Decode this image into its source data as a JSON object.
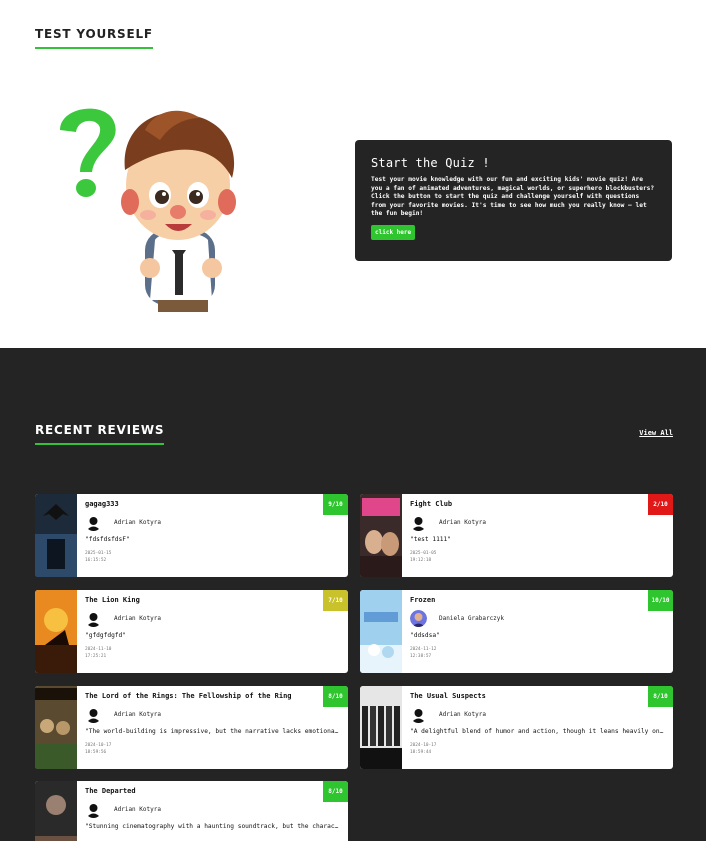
{
  "test_section": {
    "title": "TEST YOURSELF",
    "quiz": {
      "title": "Start the Quiz !",
      "text": "Test your movie knowledge with our fun and exciting kids' movie quiz! Are you a fan of animated adventures, magical worlds, or superhero blockbusters? Click the button to start the quiz and challenge yourself with questions from your favorite movies. It's time to see how much you really know – let the fun begin!",
      "button_label": "click here"
    }
  },
  "reviews_section": {
    "title": "RECENT REVIEWS",
    "view_all": "View All",
    "reviews": [
      {
        "title": "gagag333",
        "user": "Adrian Kotyra",
        "comment": "\"fdsfdsfdsF\"",
        "date": "2025-01-15",
        "time": "16:15:52",
        "score": "9/10",
        "score_color": "#2fc52f",
        "poster": "batman"
      },
      {
        "title": "Fight Club",
        "user": "Adrian Kotyra",
        "comment": "\"test 1111\"",
        "date": "2025-01-05",
        "time": "19:12:18",
        "score": "2/10",
        "score_color": "#e01818",
        "poster": "fightclub"
      },
      {
        "title": "The Lion King",
        "user": "Adrian Kotyra",
        "comment": "\"gfdgfdgfd\"",
        "date": "2024-11-10",
        "time": "17:25:21",
        "score": "7/10",
        "score_color": "#c9c22a",
        "poster": "lionking"
      },
      {
        "title": "Frozen",
        "user": "Daniela Grabarczyk",
        "comment": "\"ddsdsa\"",
        "date": "2024-11-12",
        "time": "12:38:57",
        "score": "10/10",
        "score_color": "#2fc52f",
        "poster": "frozen"
      },
      {
        "title": "The Lord of the Rings: The Fellowship of the Ring",
        "user": "Adrian Kotyra",
        "comment": "\"The world-building is impressive, but the narrative lacks emotional depth.\"",
        "date": "2024-10-17",
        "time": "18:59:56",
        "score": "8/10",
        "score_color": "#2fc52f",
        "poster": "lotr"
      },
      {
        "title": "The Usual Suspects",
        "user": "Adrian Kotyra",
        "comment": "\"A delightful blend of humor and action, though it leans heavily on clichés.\"",
        "date": "2024-10-17",
        "time": "18:59:44",
        "score": "8/10",
        "score_color": "#2fc52f",
        "poster": "usualsuspects"
      },
      {
        "title": "The Departed",
        "user": "Adrian Kotyra",
        "comment": "\"Stunning cinematography with a haunting soundtrack, but the characters feel flat.\"",
        "date": "",
        "time": "",
        "score": "8/10",
        "score_color": "#2fc52f",
        "poster": "departed"
      }
    ]
  }
}
